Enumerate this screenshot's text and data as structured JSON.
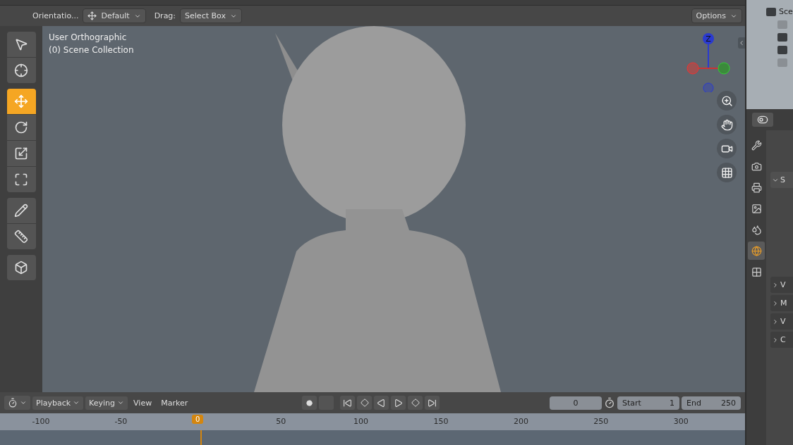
{
  "tool_settings": {
    "orientation_label": "Orientatio...",
    "orientation_value": "Default",
    "drag_label": "Drag:",
    "drag_value": "Select Box",
    "options": "Options"
  },
  "viewport": {
    "view_name": "User Orthographic",
    "collection": "(0) Scene Collection",
    "gizmo_axis": "Z"
  },
  "tool_groups": [
    {
      "tools": [
        {
          "kind": "select",
          "selected": false
        },
        {
          "kind": "cursor",
          "selected": false
        }
      ]
    },
    {
      "tools": [
        {
          "kind": "move",
          "selected": true
        },
        {
          "kind": "rotate",
          "selected": false
        },
        {
          "kind": "scale",
          "selected": false
        },
        {
          "kind": "transform",
          "selected": false
        }
      ]
    },
    {
      "tools": [
        {
          "kind": "annotate",
          "selected": false
        },
        {
          "kind": "measure",
          "selected": false
        }
      ]
    },
    {
      "tools": [
        {
          "kind": "add-cube",
          "selected": false
        }
      ]
    }
  ],
  "outliner": {
    "scene_label": "Sce"
  },
  "properties": {
    "tabs": [
      {
        "kind": "tool",
        "selected": false
      },
      {
        "kind": "render",
        "selected": false
      },
      {
        "kind": "output",
        "selected": false
      },
      {
        "kind": "view-layer",
        "selected": false
      },
      {
        "kind": "scene",
        "selected": false
      },
      {
        "kind": "world",
        "selected": true
      },
      {
        "kind": "texture",
        "selected": false
      }
    ],
    "section": {
      "label": "S",
      "expanded": true
    },
    "panels": [
      {
        "label": "V",
        "expanded": false
      },
      {
        "label": "M",
        "expanded": false
      },
      {
        "label": "V",
        "expanded": false
      },
      {
        "label": "C",
        "expanded": false
      }
    ]
  },
  "timeline": {
    "menus": [
      {
        "label": "Playback",
        "kind": "dropdown"
      },
      {
        "label": "Keying",
        "kind": "dropdown"
      },
      {
        "label": "View",
        "kind": "plain"
      },
      {
        "label": "Marker",
        "kind": "plain"
      }
    ],
    "current_frame": "0",
    "start_label": "Start",
    "start": "1",
    "end_label": "End",
    "end": "250",
    "playhead": "0",
    "ruler": [
      "-100",
      "-50",
      "50",
      "100",
      "150",
      "200",
      "250",
      "300"
    ]
  }
}
